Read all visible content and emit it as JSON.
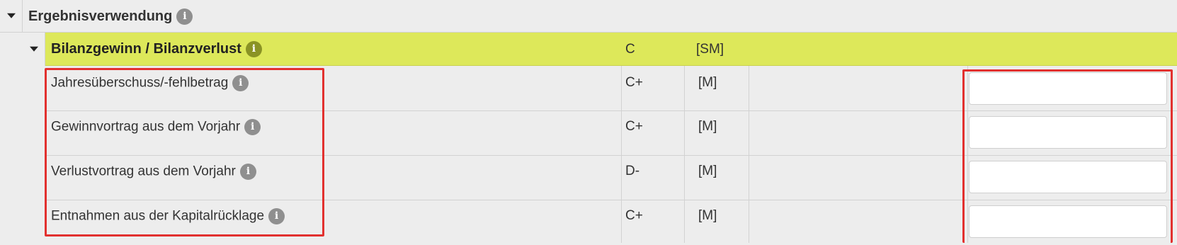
{
  "section": {
    "title": "Ergebnisverwendung",
    "info_icon": "info-icon"
  },
  "group": {
    "title": "Bilanzgewinn / Bilanzverlust",
    "code": "C",
    "unit": "[SM]",
    "info_icon": "info-icon",
    "highlight_color": "#dde85a"
  },
  "rows": [
    {
      "label": "Jahresüberschuss/-fehlbetrag",
      "code": "C+",
      "unit": "[M]",
      "value": ""
    },
    {
      "label": "Gewinnvortrag aus dem Vorjahr",
      "code": "C+",
      "unit": "[M]",
      "value": ""
    },
    {
      "label": "Verlustvortrag aus dem Vorjahr",
      "code": "D-",
      "unit": "[M]",
      "value": ""
    },
    {
      "label": "Entnahmen aus der Kapitalrücklage",
      "code": "C+",
      "unit": "[M]",
      "value": ""
    }
  ],
  "annotation": {
    "box_color": "#e2312f"
  }
}
